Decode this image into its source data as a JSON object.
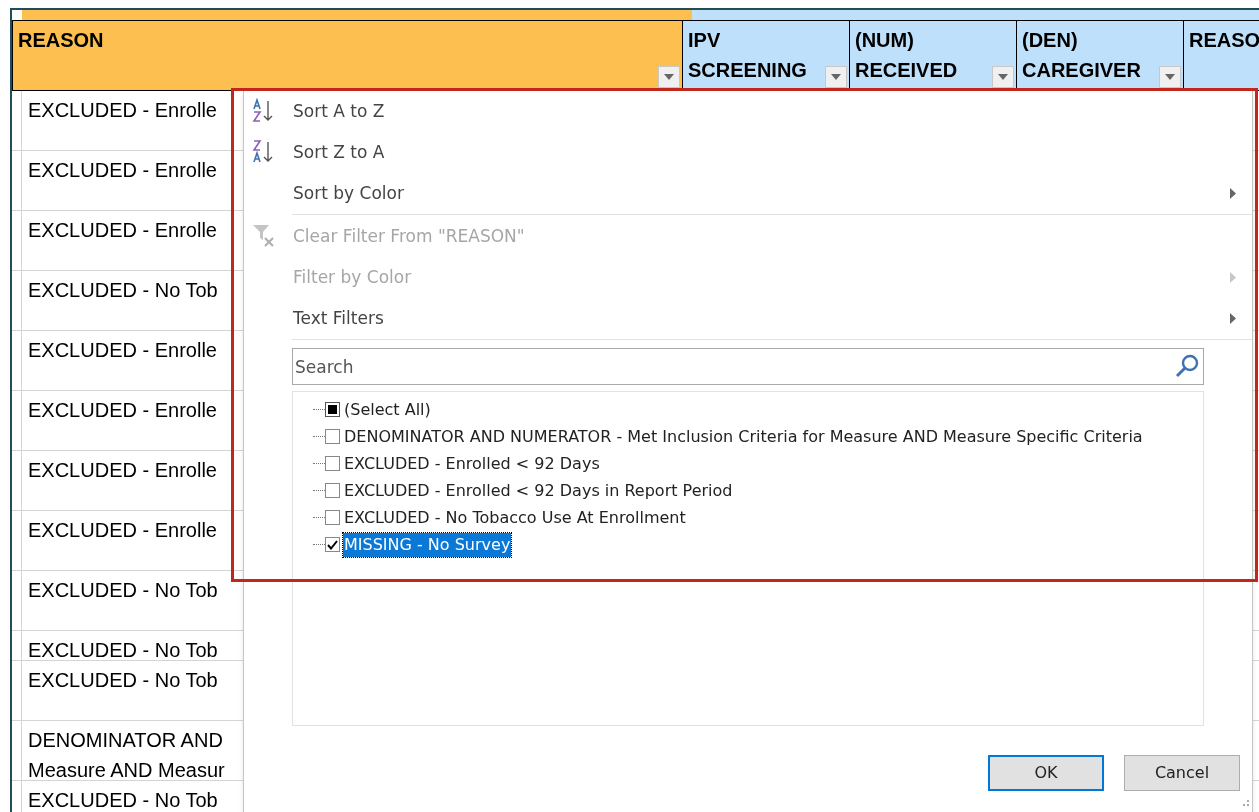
{
  "sheet": {
    "columns": [
      {
        "label": "REASON",
        "kind": "reason",
        "filter_button": true
      },
      {
        "label": "IPV SCREENING",
        "kind": "info",
        "filter_button": true
      },
      {
        "label": "(NUM) RECEIVED",
        "kind": "info",
        "filter_button": true
      },
      {
        "label": "(DEN) CAREGIVER",
        "kind": "info",
        "filter_button": true
      },
      {
        "label": "REASO",
        "kind": "info",
        "filter_button": false
      }
    ],
    "rows": [
      {
        "lines": [
          "EXCLUDED - Enrolle"
        ]
      },
      {
        "lines": [
          "EXCLUDED - Enrolle"
        ]
      },
      {
        "lines": [
          "EXCLUDED - Enrolle"
        ]
      },
      {
        "lines": [
          "EXCLUDED - No Tob"
        ]
      },
      {
        "lines": [
          "EXCLUDED - Enrolle"
        ]
      },
      {
        "lines": [
          "EXCLUDED - Enrolle"
        ]
      },
      {
        "lines": [
          "EXCLUDED - Enrolle"
        ]
      },
      {
        "lines": [
          "EXCLUDED - Enrolle"
        ]
      },
      {
        "lines": [
          "EXCLUDED - No Tob"
        ]
      },
      {
        "lines": [
          "EXCLUDED - No Tob"
        ]
      },
      {
        "lines": [
          "EXCLUDED - No Tob"
        ]
      },
      {
        "lines": [
          "DENOMINATOR AND",
          "Measure AND Measur"
        ]
      },
      {
        "lines": [
          "EXCLUDED - No Tob"
        ]
      }
    ]
  },
  "filter_menu": {
    "groups": [
      [
        {
          "label": "Sort A to Z",
          "kind": "sort-az",
          "disabled": false,
          "submenu": false
        },
        {
          "label": "Sort Z to A",
          "kind": "sort-za",
          "disabled": false,
          "submenu": false
        },
        {
          "label": "Sort by Color",
          "kind": "plain",
          "disabled": false,
          "submenu": true
        }
      ],
      [
        {
          "label": "Clear Filter From \"REASON\"",
          "kind": "clear-filter",
          "disabled": true,
          "submenu": false
        },
        {
          "label": "Filter by Color",
          "kind": "plain",
          "disabled": true,
          "submenu": true
        },
        {
          "label": "Text Filters",
          "kind": "plain",
          "disabled": false,
          "submenu": true
        }
      ]
    ],
    "search": {
      "placeholder": "Search"
    },
    "select_all": {
      "label": "(Select All)",
      "partial": true
    },
    "values": [
      {
        "label": "DENOMINATOR AND NUMERATOR  - Met Inclusion Criteria for Measure AND Measure Specific Criteria",
        "checked": false,
        "selected": false
      },
      {
        "label": "EXCLUDED - Enrolled < 92 Days",
        "checked": false,
        "selected": false
      },
      {
        "label": "EXCLUDED - Enrolled < 92 Days in Report Period",
        "checked": false,
        "selected": false
      },
      {
        "label": "EXCLUDED - No Tobacco Use At Enrollment",
        "checked": false,
        "selected": false
      },
      {
        "label": "MISSING - No Survey",
        "checked": true,
        "selected": true
      }
    ],
    "buttons": [
      {
        "label": "OK",
        "default": true
      },
      {
        "label": "Cancel",
        "default": false
      }
    ]
  },
  "highlight": {
    "shown": true
  }
}
